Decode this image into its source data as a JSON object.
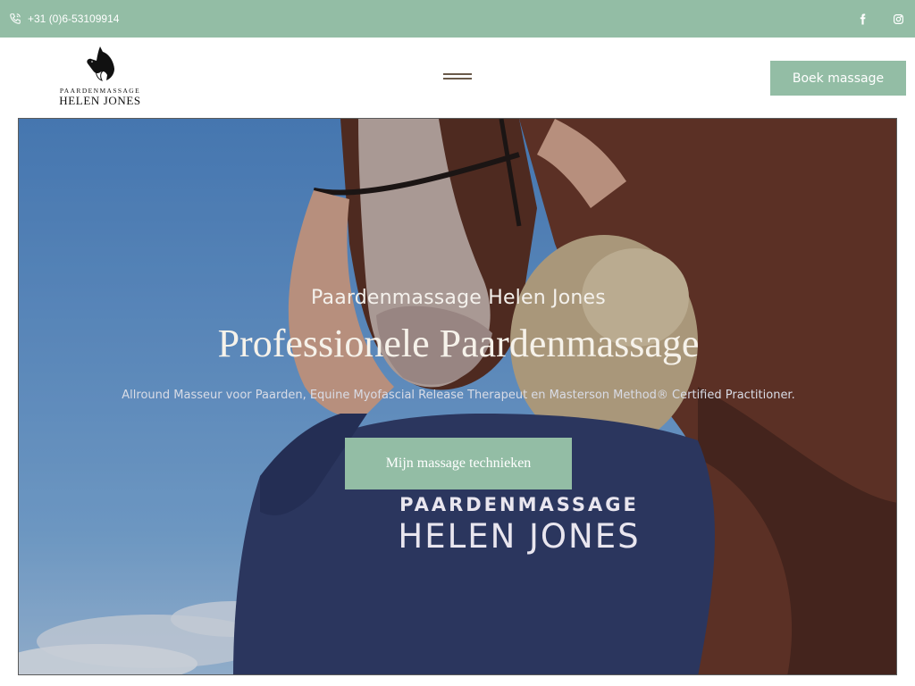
{
  "topbar": {
    "phone": "+31 (0)6-53109914",
    "icons": {
      "phone": "phone-icon",
      "facebook": "facebook-icon",
      "instagram": "instagram-icon"
    }
  },
  "header": {
    "logo": {
      "line1": "PAARDENMASSAGE",
      "line2": "HELEN JONES"
    },
    "menu_icon": "hamburger-icon",
    "book_label": "Boek massage"
  },
  "hero": {
    "subtitle": "Paardenmassage Helen Jones",
    "title": "Professionele Paardenmassage",
    "description": "Allround Masseur voor Paarden, Equine Myofascial Release Therapeut en Masterson Method® Certified Practitioner.",
    "cta_label": "Mijn massage technieken",
    "shirt_line1": "PAARDENMASSAGE",
    "shirt_line2": "HELEN JONES"
  },
  "colors": {
    "accent": "#93bda5",
    "menu": "#6a5a4a"
  }
}
